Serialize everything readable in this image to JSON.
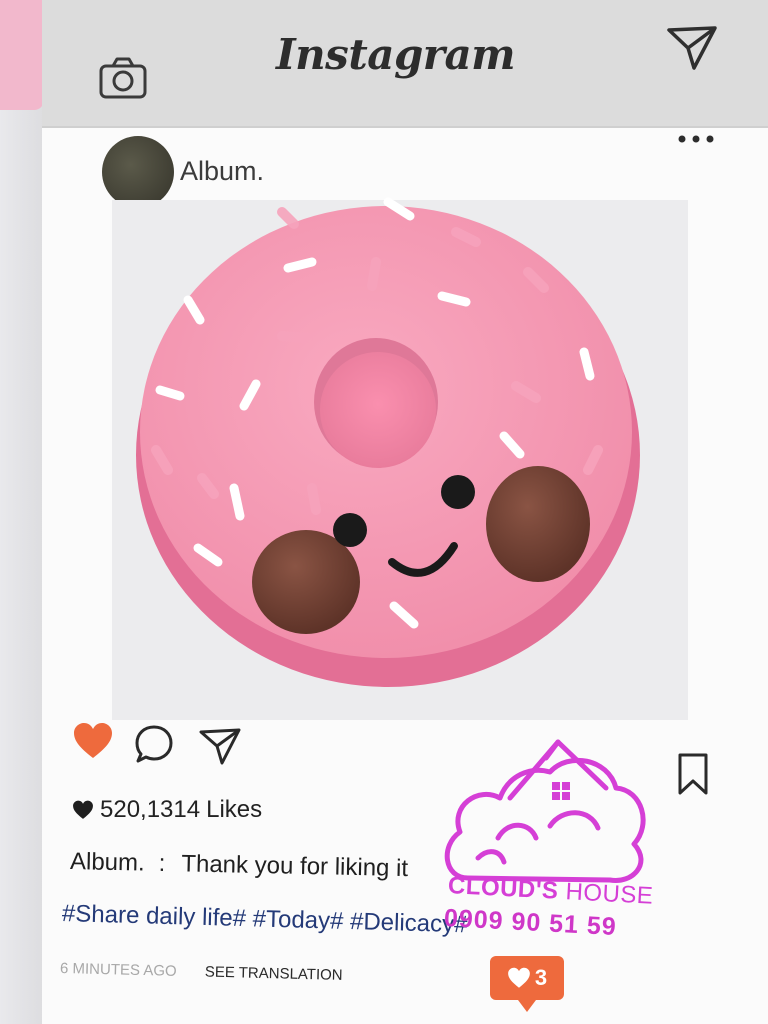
{
  "header": {
    "logo_text": "Instagram",
    "camera_icon": "camera-icon",
    "send_icon": "paper-plane-icon",
    "color": "#dcdcdc"
  },
  "post": {
    "username": "Album.",
    "more_icon": "more-horizontal-icon",
    "photo_subject": "pink-donut-popsocket",
    "actions": {
      "like_icon": "heart-icon",
      "like_color": "#ee6a3d",
      "comment_icon": "comment-icon",
      "share_icon": "paper-plane-icon",
      "save_icon": "bookmark-icon"
    },
    "likes_count": "520,1314",
    "likes_label": "Likes",
    "caption_user": "Album.",
    "caption_sep": ":",
    "caption_text": "Thank you for liking it",
    "hashtags": "#Share daily life# #Today# #Delicacy#",
    "time_ago": "6 MINUTES AGO",
    "see_translation": "SEE TRANSLATION"
  },
  "notification": {
    "icon": "heart-icon",
    "count": "3",
    "color": "#ee6a3d"
  },
  "stamp": {
    "brand_bold": "CLOUD'S",
    "brand_rest": "HOUSE",
    "phone": "0909 90 51 59",
    "color": "#d53fd6"
  }
}
